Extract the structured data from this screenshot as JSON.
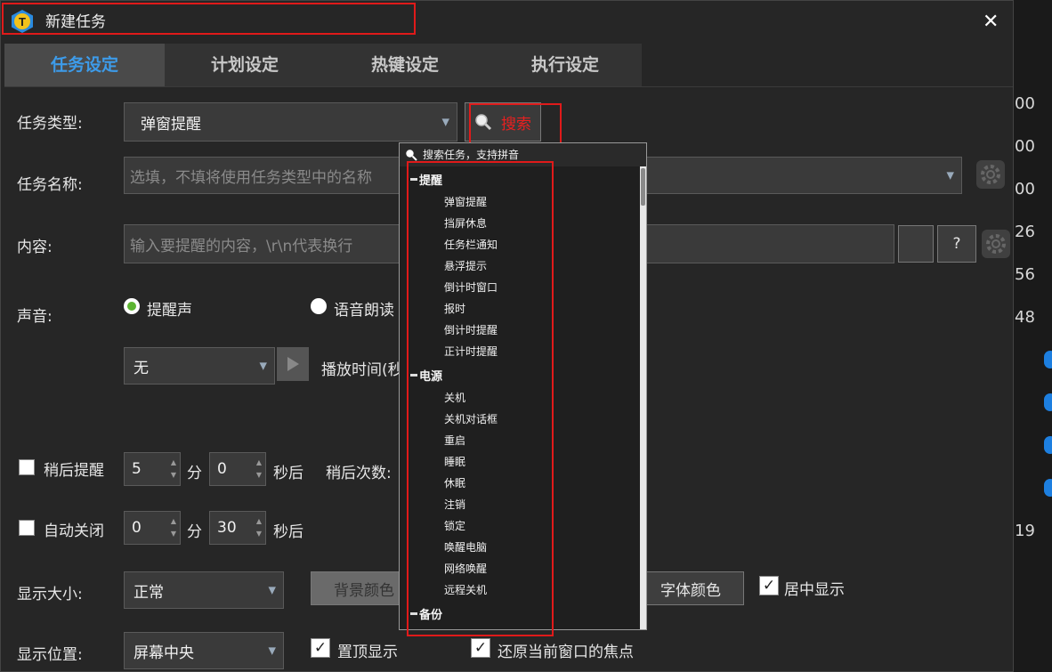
{
  "window": {
    "title": "新建任务",
    "close_label": "✕"
  },
  "tabs": [
    {
      "label": "任务设定"
    },
    {
      "label": "计划设定"
    },
    {
      "label": "热键设定"
    },
    {
      "label": "执行设定"
    }
  ],
  "task_type": {
    "label": "任务类型:",
    "value": "弹窗提醒",
    "search_label": "搜索"
  },
  "task_name": {
    "label": "任务名称:",
    "placeholder": "选填，不填将使用任务类型中的名称"
  },
  "content": {
    "label": "内容:",
    "placeholder": "输入要提醒的内容，\\r\\n代表换行",
    "help_label": "?"
  },
  "sound": {
    "label": "声音:",
    "options": [
      "提醒声",
      "语音朗读"
    ],
    "selected": "提醒声",
    "sound_value": "无",
    "play_time_label": "播放时间(秒"
  },
  "snooze": {
    "label": "稍后提醒",
    "minutes": "5",
    "min_unit": "分",
    "seconds": "0",
    "sec_unit": "秒后",
    "count_label": "稍后次数:"
  },
  "auto_close": {
    "label": "自动关闭",
    "minutes": "0",
    "min_unit": "分",
    "seconds": "30",
    "sec_unit": "秒后"
  },
  "display_size": {
    "label": "显示大小:",
    "value": "正常",
    "bg_color_label": "背景颜色",
    "font_color_label": "字体颜色",
    "center_label": "居中显示"
  },
  "display_pos": {
    "label": "显示位置:",
    "value": "屏幕中央",
    "topmost_label": "置顶显示",
    "restore_focus_label": "还原当前窗口的焦点"
  },
  "popup": {
    "search_placeholder": "搜索任务，支持拼音",
    "groups": [
      {
        "name": "提醒",
        "items": [
          "弹窗提醒",
          "挡屏休息",
          "任务栏通知",
          "悬浮提示",
          "倒计时窗口",
          "报时",
          "倒计时提醒",
          "正计时提醒"
        ]
      },
      {
        "name": "电源",
        "items": [
          "关机",
          "关机对话框",
          "重启",
          "睡眠",
          "休眠",
          "注销",
          "锁定",
          "唤醒电脑",
          "网络唤醒",
          "远程关机"
        ]
      },
      {
        "name": "备份",
        "items": []
      }
    ]
  },
  "background_numbers": [
    "00",
    "00",
    "00",
    "26",
    "56",
    "48",
    "19"
  ],
  "colors": {
    "accent": "#3d9be9",
    "highlight_box": "#e01a1a",
    "radio_on": "#5cb531"
  }
}
